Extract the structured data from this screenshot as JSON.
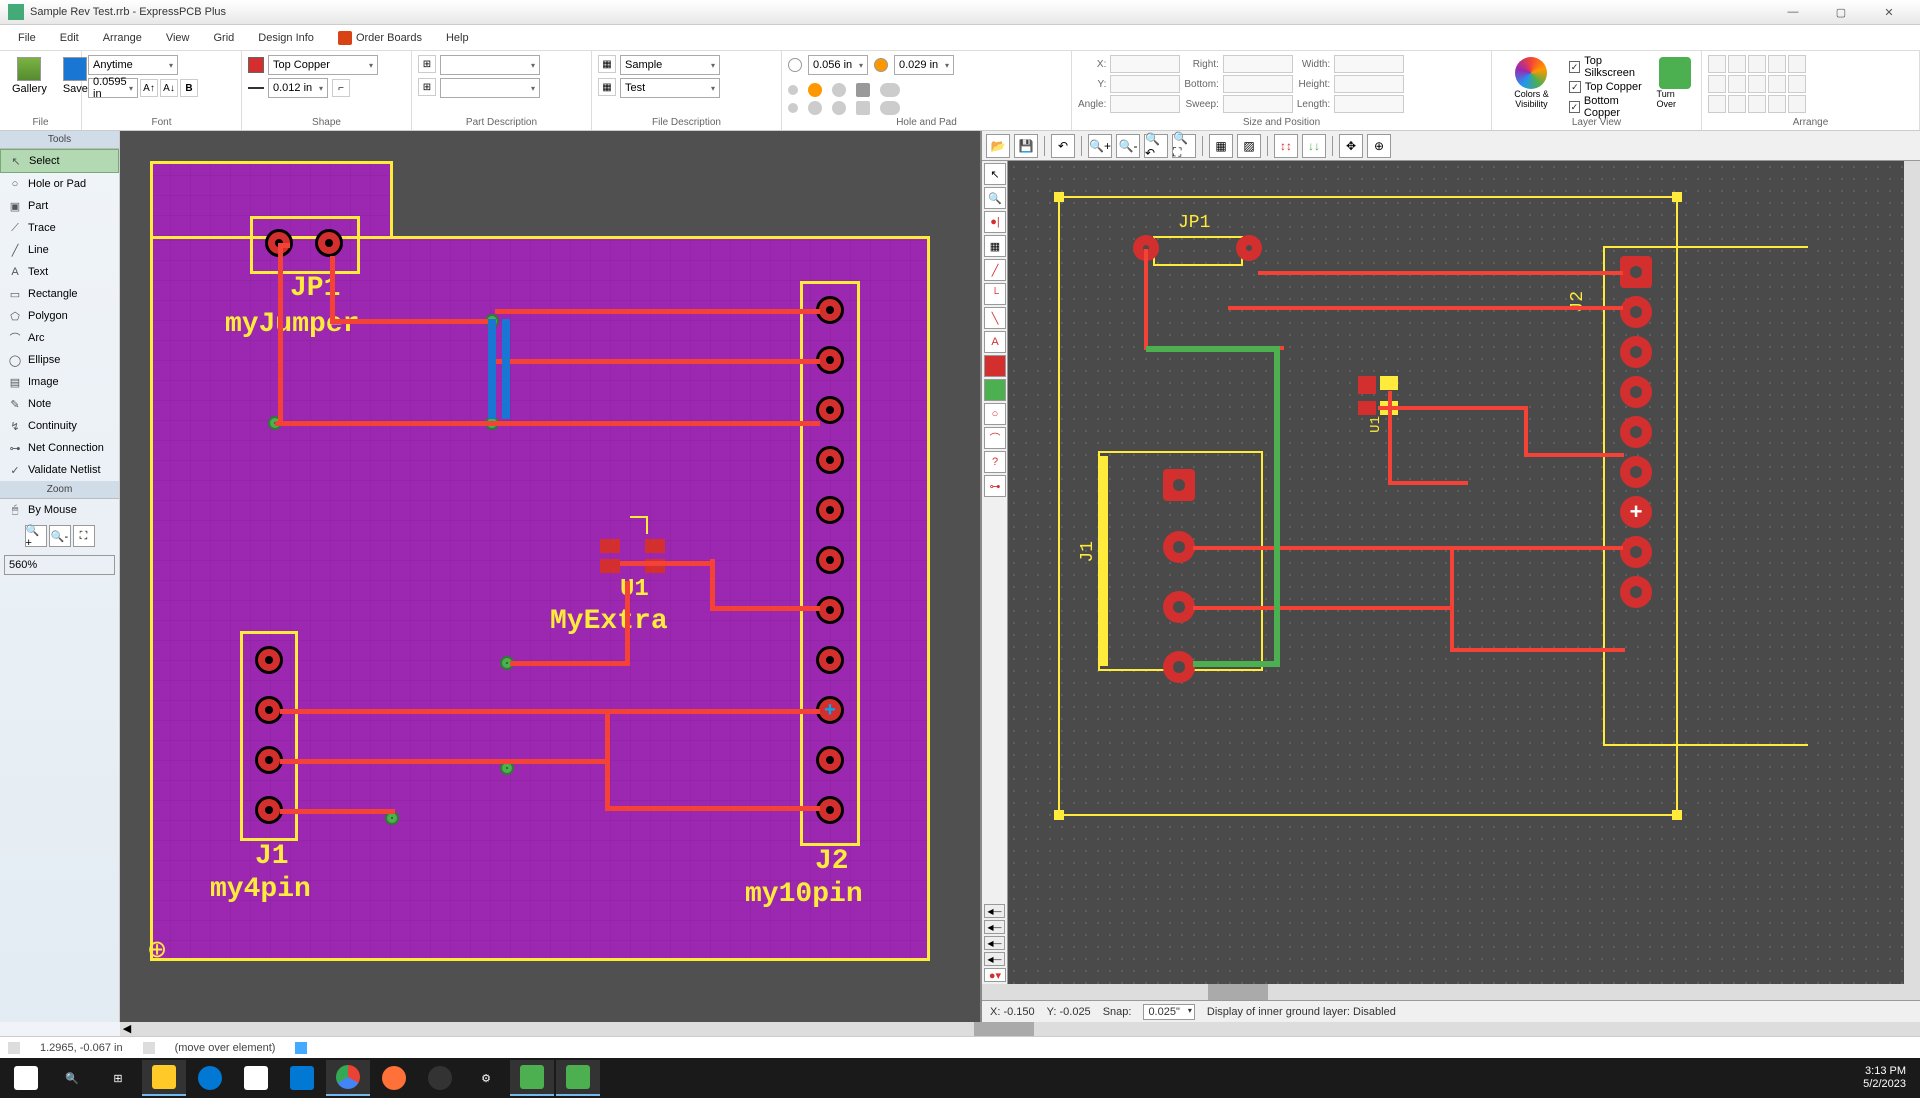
{
  "titlebar": {
    "text": "Sample Rev Test.rrb - ExpressPCB Plus"
  },
  "menu": {
    "file": "File",
    "edit": "Edit",
    "arrange": "Arrange",
    "view": "View",
    "grid": "Grid",
    "design_info": "Design Info",
    "order_boards": "Order Boards",
    "help": "Help"
  },
  "ribbon": {
    "file": {
      "label": "File",
      "gallery": "Gallery",
      "save": "Save"
    },
    "font": {
      "label": "Font",
      "family": "Anytime",
      "size": "0.0595 in"
    },
    "shape": {
      "label": "Shape",
      "layer": "Top Copper",
      "width": "0.012 in"
    },
    "part_desc": {
      "label": "Part Description"
    },
    "file_desc": {
      "label": "File Description",
      "row1": "Sample",
      "row2": "Test"
    },
    "hole_pad": {
      "label": "Hole and Pad",
      "hole": "0.056 in",
      "pad": "0.029 in"
    },
    "size_pos": {
      "label": "Size and Position",
      "x": "X:",
      "y": "Y:",
      "angle": "Angle:",
      "right": "Right:",
      "bottom": "Bottom:",
      "sweep": "Sweep:",
      "width": "Width:",
      "height": "Height:",
      "length": "Length:"
    },
    "layer_view": {
      "label": "Layer View",
      "colors": "Colors & Visibility",
      "turnover": "Turn Over",
      "top_silk": "Top Silkscreen",
      "top_copper": "Top Copper",
      "bottom_copper": "Bottom Copper"
    },
    "arrange": {
      "label": "Arrange"
    }
  },
  "tools": {
    "header": "Tools",
    "select": "Select",
    "hole_or_pad": "Hole or Pad",
    "part": "Part",
    "trace": "Trace",
    "line": "Line",
    "text": "Text",
    "rectangle": "Rectangle",
    "polygon": "Polygon",
    "arc": "Arc",
    "ellipse": "Ellipse",
    "image": "Image",
    "note": "Note",
    "continuity": "Continuity",
    "net_connection": "Net Connection",
    "validate": "Validate Netlist"
  },
  "zoom": {
    "header": "Zoom",
    "by_mouse": "By Mouse",
    "level": "560%"
  },
  "left_pcb": {
    "labels": {
      "jp1": "JP1",
      "myjumper": "myJumper",
      "u1": "U1",
      "myextra": "MyExtra",
      "j1": "J1",
      "my4pin": "my4pin",
      "j2": "J2",
      "my10pin": "my10pin"
    }
  },
  "right_pcb": {
    "labels": {
      "jp1": "JP1",
      "j2": "J2",
      "u1": "U1",
      "j1": "J1"
    }
  },
  "right_status": {
    "x": "X: -0.150",
    "y": "Y: -0.025",
    "snap_label": "Snap:",
    "snap_val": "0.025\"",
    "display": "Display of inner ground layer:  Disabled"
  },
  "statusbar": {
    "coords": "1.2965, -0.067 in",
    "hint": "(move over element)"
  },
  "clock": {
    "time": "3:13 PM",
    "date": "5/2/2023"
  }
}
